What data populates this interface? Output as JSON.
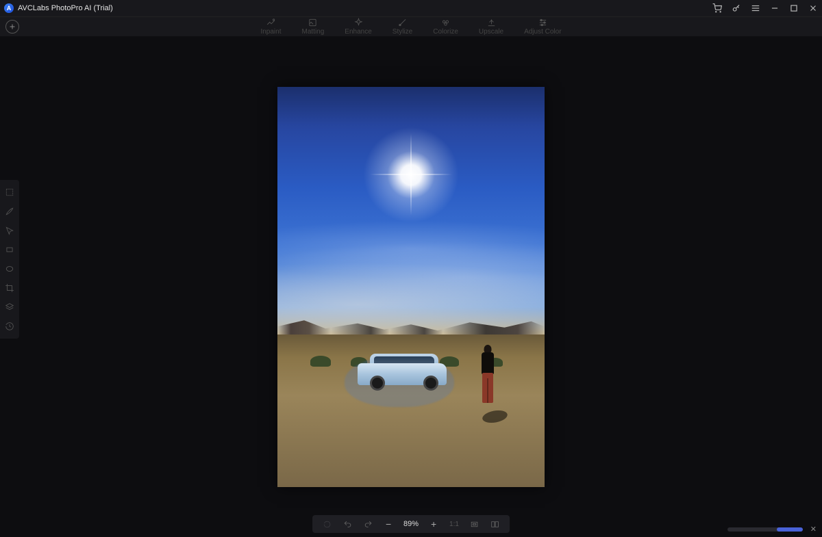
{
  "app": {
    "title": "AVCLabs PhotoPro AI (Trial)",
    "logo_letter": "A"
  },
  "toolbar": {
    "tabs": [
      {
        "id": "inpaint",
        "label": "Inpaint"
      },
      {
        "id": "matting",
        "label": "Matting"
      },
      {
        "id": "enhance",
        "label": "Enhance"
      },
      {
        "id": "stylize",
        "label": "Stylize"
      },
      {
        "id": "colorize",
        "label": "Colorize"
      },
      {
        "id": "upscale",
        "label": "Upscale"
      },
      {
        "id": "adjust",
        "label": "Adjust Color"
      }
    ]
  },
  "zoom": {
    "value": "89%",
    "one_to_one": "1:1"
  },
  "side_tools": [
    "marquee",
    "brush",
    "pointer",
    "rectangle",
    "ellipse",
    "crop",
    "color-adjust",
    "layers",
    "history"
  ]
}
